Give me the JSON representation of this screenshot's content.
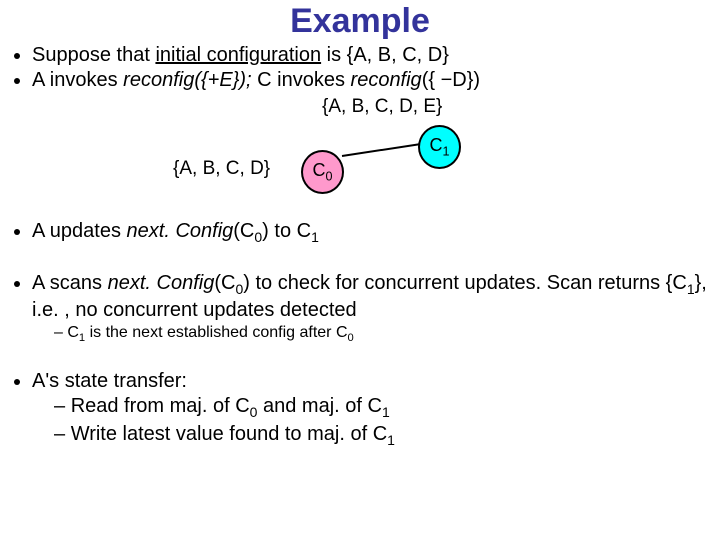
{
  "title": "Example",
  "bullets": {
    "b1_a": "Suppose that ",
    "b1_b": "initial configuration",
    "b1_c": " is {A, B, C, D}",
    "b2_a": "A invokes ",
    "b2_b": "reconfig",
    "b2_c": "({+E})",
    "b2_d": "; ",
    "b2_e": "C invokes ",
    "b2_f": "reconfig",
    "b2_g": "({ −D})"
  },
  "diagram": {
    "top_label": "{A, B, C, D, E}",
    "left_label": "{A, B, C, D}",
    "c0": "C",
    "c0_sub": "0",
    "c1": "C",
    "c1_sub": "1"
  },
  "main": {
    "m1_a": "A updates ",
    "m1_b": "next. Config",
    "m1_c": "(C",
    "m1_sub0": "0",
    "m1_d": ") to C",
    "m1_sub1": "1",
    "m2_a": "A scans ",
    "m2_b": "next. Config",
    "m2_c": "(C",
    "m2_sub0": "0",
    "m2_d": ") to check for concurrent updates. Scan returns {C",
    "m2_sub1": "1",
    "m2_e": "}, i.e. , no concurrent updates detected",
    "m2_sub_line_a": "C",
    "m2_sub_line_sub1": "1",
    "m2_sub_line_b": " is the next established config after C",
    "m2_sub_line_sub0": "0",
    "m3": "A's state transfer:",
    "m3_sub1_a": "Read from maj. of C",
    "m3_sub1_sub0": "0",
    "m3_sub1_b": " and maj. of C",
    "m3_sub1_sub1": "1",
    "m3_sub2_a": "Write latest value found to maj. of C",
    "m3_sub2_sub1": "1"
  }
}
